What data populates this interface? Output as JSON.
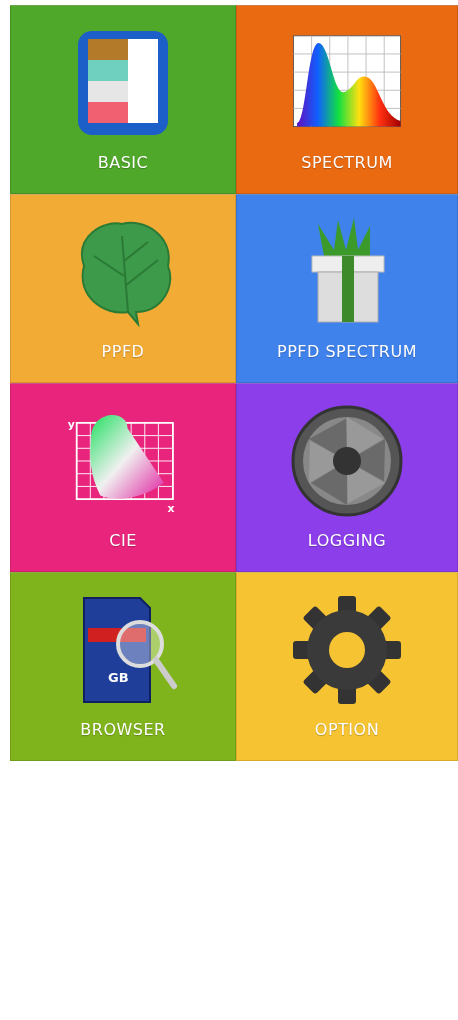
{
  "tiles": [
    {
      "label": "BASIC",
      "kind": "swatches",
      "color": "#4fa82a"
    },
    {
      "label": "SPECTRUM",
      "kind": "spectrum",
      "color": "#ea6a12"
    },
    {
      "label": "PPFD",
      "kind": "leaf",
      "color": "#f2ab35"
    },
    {
      "label": "PPFD SPECTRUM",
      "kind": "gift",
      "color": "#3f82ec"
    },
    {
      "label": "CIE",
      "kind": "cie",
      "color": "#e8247c",
      "icon_texts": [
        "y",
        "x"
      ]
    },
    {
      "label": "LOGGING",
      "kind": "aperture",
      "color": "#8b3eea"
    },
    {
      "label": "BROWSER",
      "kind": "sdcard",
      "color": "#80b41c",
      "icon_texts": [
        "GB"
      ]
    },
    {
      "label": "OPTION",
      "kind": "gear",
      "color": "#f6c332"
    }
  ]
}
